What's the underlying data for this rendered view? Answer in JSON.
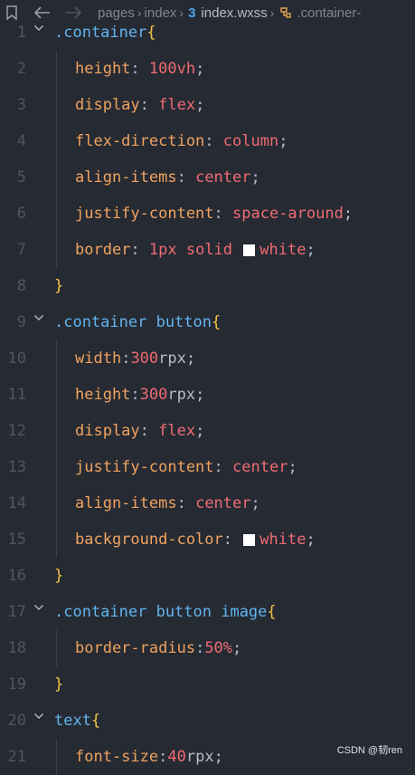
{
  "breadcrumb": {
    "items": [
      "pages",
      "index"
    ],
    "file_badge": "3",
    "file": "index.wxss",
    "symbol": ".container-"
  },
  "lines": [
    {
      "n": "1",
      "fold": true,
      "indent": 0,
      "tokens": [
        {
          "t": ".container",
          "c": "sel"
        },
        {
          "t": "{",
          "c": "brace"
        }
      ]
    },
    {
      "n": "2",
      "fold": false,
      "indent": 1,
      "tokens": [
        {
          "t": "height",
          "c": "prop"
        },
        {
          "t": ": ",
          "c": "punc"
        },
        {
          "t": "100vh",
          "c": "val"
        },
        {
          "t": ";",
          "c": "punc"
        }
      ]
    },
    {
      "n": "3",
      "fold": false,
      "indent": 1,
      "tokens": [
        {
          "t": "display",
          "c": "prop"
        },
        {
          "t": ": ",
          "c": "punc"
        },
        {
          "t": "flex",
          "c": "val"
        },
        {
          "t": ";",
          "c": "punc"
        }
      ]
    },
    {
      "n": "4",
      "fold": false,
      "indent": 1,
      "tokens": [
        {
          "t": "flex-direction",
          "c": "prop"
        },
        {
          "t": ": ",
          "c": "punc"
        },
        {
          "t": "column",
          "c": "val"
        },
        {
          "t": ";",
          "c": "punc"
        }
      ]
    },
    {
      "n": "5",
      "fold": false,
      "indent": 1,
      "tokens": [
        {
          "t": "align-items",
          "c": "prop"
        },
        {
          "t": ": ",
          "c": "punc"
        },
        {
          "t": "center",
          "c": "val"
        },
        {
          "t": ";",
          "c": "punc"
        }
      ]
    },
    {
      "n": "6",
      "fold": false,
      "indent": 1,
      "tokens": [
        {
          "t": "justify-content",
          "c": "prop"
        },
        {
          "t": ": ",
          "c": "punc"
        },
        {
          "t": "space-around",
          "c": "val"
        },
        {
          "t": ";",
          "c": "punc"
        }
      ]
    },
    {
      "n": "7",
      "fold": false,
      "indent": 1,
      "tokens": [
        {
          "t": "border",
          "c": "prop"
        },
        {
          "t": ": ",
          "c": "punc"
        },
        {
          "t": "1px solid ",
          "c": "val"
        },
        {
          "t": "",
          "c": "swatch"
        },
        {
          "t": "white",
          "c": "val"
        },
        {
          "t": ";",
          "c": "punc"
        }
      ]
    },
    {
      "n": "8",
      "fold": false,
      "indent": 0,
      "tokens": [
        {
          "t": "}",
          "c": "brace"
        }
      ]
    },
    {
      "n": "9",
      "fold": true,
      "indent": 0,
      "tokens": [
        {
          "t": ".container button",
          "c": "sel"
        },
        {
          "t": "{",
          "c": "brace"
        }
      ]
    },
    {
      "n": "10",
      "fold": false,
      "indent": 1,
      "tokens": [
        {
          "t": "width",
          "c": "prop"
        },
        {
          "t": ":",
          "c": "punc"
        },
        {
          "t": "300",
          "c": "val"
        },
        {
          "t": "rpx",
          "c": "unit"
        },
        {
          "t": ";",
          "c": "punc"
        }
      ]
    },
    {
      "n": "11",
      "fold": false,
      "indent": 1,
      "tokens": [
        {
          "t": "height",
          "c": "prop"
        },
        {
          "t": ":",
          "c": "punc"
        },
        {
          "t": "300",
          "c": "val"
        },
        {
          "t": "rpx",
          "c": "unit"
        },
        {
          "t": ";",
          "c": "punc"
        }
      ]
    },
    {
      "n": "12",
      "fold": false,
      "indent": 1,
      "tokens": [
        {
          "t": "display",
          "c": "prop"
        },
        {
          "t": ": ",
          "c": "punc"
        },
        {
          "t": "flex",
          "c": "val"
        },
        {
          "t": ";",
          "c": "punc"
        }
      ]
    },
    {
      "n": "13",
      "fold": false,
      "indent": 1,
      "tokens": [
        {
          "t": "justify-content",
          "c": "prop"
        },
        {
          "t": ": ",
          "c": "punc"
        },
        {
          "t": "center",
          "c": "val"
        },
        {
          "t": ";",
          "c": "punc"
        }
      ]
    },
    {
      "n": "14",
      "fold": false,
      "indent": 1,
      "tokens": [
        {
          "t": "align-items",
          "c": "prop"
        },
        {
          "t": ": ",
          "c": "punc"
        },
        {
          "t": "center",
          "c": "val"
        },
        {
          "t": ";",
          "c": "punc"
        }
      ]
    },
    {
      "n": "15",
      "fold": false,
      "indent": 1,
      "tokens": [
        {
          "t": "background-color",
          "c": "prop"
        },
        {
          "t": ": ",
          "c": "punc"
        },
        {
          "t": "",
          "c": "swatch"
        },
        {
          "t": "white",
          "c": "val"
        },
        {
          "t": ";",
          "c": "punc"
        }
      ]
    },
    {
      "n": "16",
      "fold": false,
      "indent": 0,
      "tokens": [
        {
          "t": "}",
          "c": "brace"
        }
      ]
    },
    {
      "n": "17",
      "fold": true,
      "indent": 0,
      "tokens": [
        {
          "t": ".container button image",
          "c": "sel"
        },
        {
          "t": "{",
          "c": "brace"
        }
      ]
    },
    {
      "n": "18",
      "fold": false,
      "indent": 1,
      "tokens": [
        {
          "t": "border-radius",
          "c": "prop"
        },
        {
          "t": ":",
          "c": "punc"
        },
        {
          "t": "50%",
          "c": "val"
        },
        {
          "t": ";",
          "c": "punc"
        }
      ]
    },
    {
      "n": "19",
      "fold": false,
      "indent": 0,
      "tokens": [
        {
          "t": "}",
          "c": "brace"
        }
      ]
    },
    {
      "n": "20",
      "fold": true,
      "indent": 0,
      "tokens": [
        {
          "t": "text",
          "c": "sel"
        },
        {
          "t": "{",
          "c": "brace"
        }
      ]
    },
    {
      "n": "21",
      "fold": false,
      "indent": 1,
      "tokens": [
        {
          "t": "font-size",
          "c": "prop"
        },
        {
          "t": ":",
          "c": "punc"
        },
        {
          "t": "40",
          "c": "val"
        },
        {
          "t": "rpx",
          "c": "unit"
        },
        {
          "t": ";",
          "c": "punc"
        }
      ]
    }
  ],
  "watermark": "CSDN @韧ren",
  "colors": {
    "background": "#262a33",
    "selector": "#61b4ee",
    "property": "#f0a35e",
    "value": "#ef6b73",
    "brace": "#f2c744",
    "line_number": "#4f5563"
  }
}
